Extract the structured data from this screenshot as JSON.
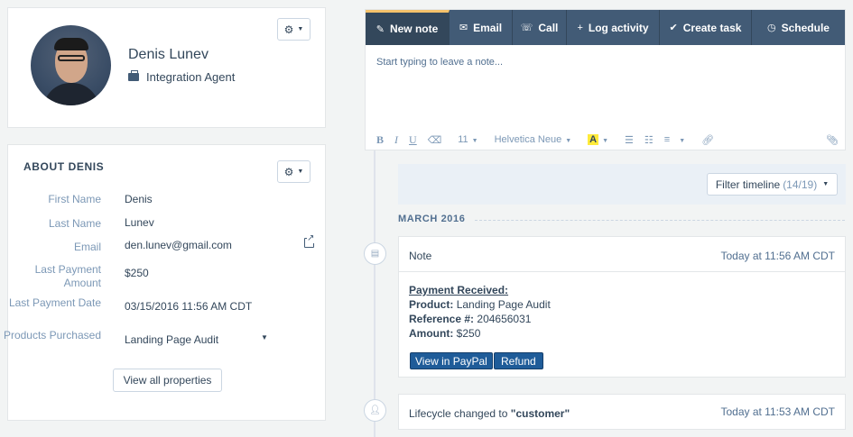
{
  "profile": {
    "name": "Denis Lunev",
    "role": "Integration Agent"
  },
  "about": {
    "title": "ABOUT DENIS",
    "properties": [
      {
        "label": "First Name",
        "value": "Denis"
      },
      {
        "label": "Last Name",
        "value": "Lunev"
      },
      {
        "label": "Email",
        "value": "den.lunev@gmail.com"
      },
      {
        "label": "Last Payment Amount",
        "value": "$250"
      },
      {
        "label": "Last Payment Date",
        "value": "03/15/2016 11:56 AM CDT"
      },
      {
        "label": "Products Purchased",
        "value": "Landing Page Audit"
      }
    ],
    "view_all_label": "View all properties"
  },
  "composer": {
    "tabs": [
      {
        "label": "New note",
        "icon": "pencil-icon"
      },
      {
        "label": "Email",
        "icon": "envelope-icon"
      },
      {
        "label": "Call",
        "icon": "phone-icon"
      },
      {
        "label": "Log activity",
        "icon": "plus-icon"
      },
      {
        "label": "Create task",
        "icon": "check-circle-icon"
      },
      {
        "label": "Schedule",
        "icon": "clock-icon"
      }
    ],
    "placeholder": "Start typing to leave a note...",
    "font_size": "11",
    "font_name": "Helvetica Neue"
  },
  "timeline": {
    "filter_label": "Filter timeline",
    "filter_count": "(14/19)",
    "month": "MARCH 2016",
    "note": {
      "type": "Note",
      "timestamp": "Today at 11:56 AM CDT",
      "heading": "Payment Received:",
      "product_label": "Product:",
      "product_value": "Landing Page Audit",
      "reference_label": "Reference #:",
      "reference_value": "204656031",
      "amount_label": "Amount:",
      "amount_value": "$250",
      "paypal_button": "View in PayPal",
      "refund_button": "Refund"
    },
    "lifecycle": {
      "text": "Lifecycle changed to",
      "stage": "\"customer\"",
      "timestamp": "Today at 11:53 AM CDT"
    }
  },
  "colors": {
    "tab_bar": "#425b76",
    "tab_active": "#33475b",
    "tab_accent": "#f5c26b",
    "button_blue": "#1f5c99"
  }
}
